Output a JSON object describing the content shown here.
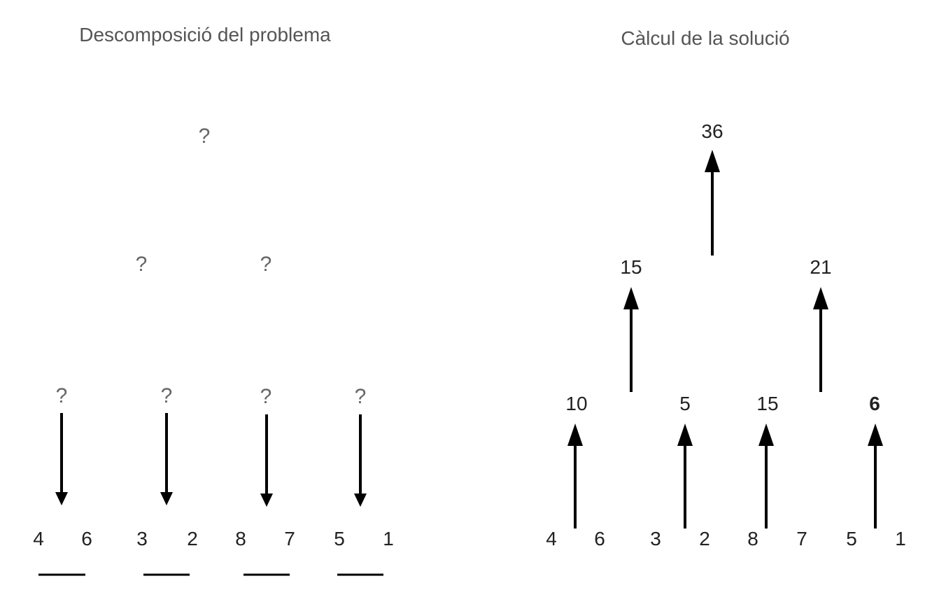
{
  "left_panel": {
    "title": "Descomposició del problema",
    "root": "?",
    "level2": [
      "?",
      "?"
    ],
    "level1": [
      "?",
      "?",
      "?",
      "?"
    ],
    "pairs": [
      [
        "4",
        "6"
      ],
      [
        "3",
        "2"
      ],
      [
        "8",
        "7"
      ],
      [
        "5",
        "1"
      ]
    ]
  },
  "right_panel": {
    "title": "Càlcul de la solució",
    "root": "36",
    "level2": [
      "15",
      "21"
    ],
    "level1": [
      "10",
      "5",
      "15",
      "6"
    ],
    "pairs": [
      [
        "4",
        "6"
      ],
      [
        "3",
        "2"
      ],
      [
        "8",
        "7"
      ],
      [
        "5",
        "1"
      ]
    ]
  }
}
